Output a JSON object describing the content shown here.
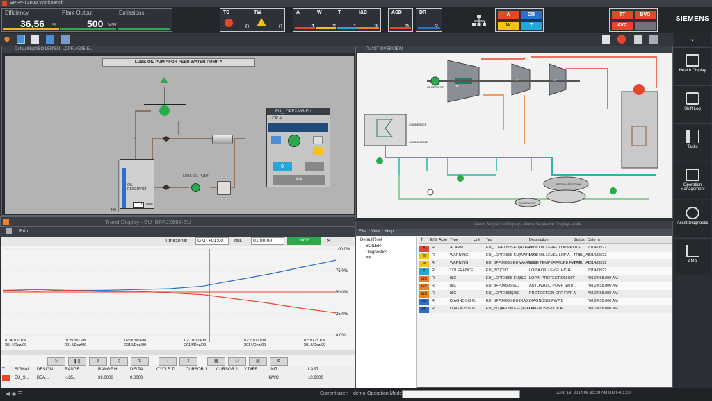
{
  "window_title": "SPPA-T3000 Workbench",
  "kpis": [
    {
      "label": "Efficiency",
      "value": "36,56",
      "unit": "%"
    },
    {
      "label": "Plant Output",
      "value": "500",
      "unit": "MW"
    },
    {
      "label": "Emissions",
      "value": "",
      "unit": ""
    }
  ],
  "alarm_groups": [
    {
      "labels": [
        "TS",
        "TW"
      ],
      "values": [
        "0",
        "0"
      ]
    },
    {
      "labels": [
        "A",
        "W",
        "T",
        "I&C"
      ],
      "values": [
        "1",
        "2",
        "1",
        "3"
      ]
    },
    {
      "labels": [
        "ASD"
      ],
      "values": [
        "9"
      ]
    },
    {
      "labels": [
        "DR"
      ],
      "values": [
        "2"
      ]
    }
  ],
  "quick_buttons_1": [
    {
      "label": "A",
      "color": "#e8462c"
    },
    {
      "label": "DR",
      "color": "#2f6fc9"
    },
    {
      "label": "W",
      "color": "#f3c21b"
    },
    {
      "label": "T",
      "color": "#23a7d9"
    }
  ],
  "quick_buttons_2": [
    {
      "label": "TT",
      "color": "#e8462c"
    },
    {
      "label": "BVG",
      "color": "#e8462c"
    },
    {
      "label": "AVC",
      "color": "#e8462c"
    },
    {
      "label": "",
      "color": "#6e737a"
    }
  ],
  "brand": "SIEMENS",
  "right_panel": [
    {
      "label": "Health Display",
      "icon": "health-display-icon"
    },
    {
      "label": "Shift Log",
      "icon": "shift-log-icon"
    },
    {
      "label": "Tasks",
      "icon": "tasks-icon"
    },
    {
      "label": "Operation Management",
      "icon": "operation-management-icon"
    },
    {
      "label": "Asset Diagnostic",
      "icon": "asset-diagnostic-icon"
    },
    {
      "label": "AMA",
      "icon": "ama-icon"
    }
  ],
  "lube_window": {
    "title": "DefaultRoot\\BOILER\\EU_LOPFLX895-EU",
    "banner": "LUBE OIL PUMP FOR FEED WATER PUMP A",
    "tank_label": "OIL RESERVOIR",
    "tank_value": "71.0",
    "tank_unit": "MMC",
    "pump_label": "LUBE OIL PUMP",
    "scale_top": "",
    "scale_bottom": "-400"
  },
  "faceplate": {
    "title": "EU_LOPFX895-EU",
    "subtitle": "LOP A",
    "input_value": "0",
    "button_label": "Ack"
  },
  "overview": {
    "title": "PLANT OVERVIEW",
    "labels": [
      "HP",
      "IP",
      "LP",
      "CONDENSER",
      "CONDENSATE",
      "FEEDWATER TANK",
      "DEAERATOR",
      "GENERATOR"
    ]
  },
  "trend": {
    "title": "Trend Display - EU_BFPJX895-EU",
    "print": "Print",
    "timezone_label": "Timezone:",
    "timezone": "GMT+01:00",
    "duration_label": "dur.:",
    "duration": "01:00:00",
    "zoom": "100%",
    "y_ticks": [
      "100.0%",
      "75.0%",
      "50.0%",
      "25.0%",
      "0.0%"
    ],
    "x_ticks": [
      [
        "01:40:00 PM",
        "2014/Dez/09"
      ],
      [
        "01:50:00 PM",
        "2014/Dez/09"
      ],
      [
        "02:00:00 PM",
        "2014/Dez/09"
      ],
      [
        "02:10:00 PM",
        "2014/Dez/09"
      ],
      [
        "02:20:00 PM",
        "2014/Dez/09"
      ],
      [
        "02:30:25 PM",
        "2014/Dez/09"
      ]
    ],
    "table_headers": [
      "T...",
      "SIGNAL ...",
      "DESIGN...",
      "RANGE L...",
      "RANGE HI",
      "DELTA",
      "CYCLE TI...",
      "CURSOR 1",
      "CURSOR 2",
      "Y DIFF",
      "UNIT",
      "LAST"
    ],
    "table_row": [
      "",
      "EU_S...",
      "BEA...",
      "-185...",
      "39.0000",
      "0.0000",
      "",
      "",
      "",
      "",
      "INWC",
      "10.0000"
    ]
  },
  "chart_data": {
    "type": "line",
    "x": [
      0,
      10,
      20,
      30,
      40,
      50,
      60,
      70,
      80,
      90,
      100
    ],
    "series": [
      {
        "values": [
          52,
          51,
          52,
          52,
          53,
          54,
          57,
          64,
          71,
          79,
          87
        ]
      },
      {
        "values": [
          52,
          53,
          52,
          51,
          51,
          49,
          47,
          42,
          37,
          31,
          26
        ]
      }
    ],
    "ylim": [
      0,
      100
    ]
  },
  "alarms": {
    "title": "Alarm Sequence Display - Alarm Sequence Display - AMA",
    "menu": [
      "File",
      "View",
      "Help"
    ],
    "tree": [
      "DefaultRoot",
      "BOILER",
      "Diagnostics",
      "EB"
    ],
    "headers": [
      "T",
      "E/S",
      "Actio",
      "Type",
      "Unit",
      "Tag",
      "Description",
      "Status",
      "Date m"
    ],
    "rows": [
      {
        "sev": "A",
        "color": "#e8462c",
        "es": "R",
        "type": "ALARM",
        "tag": "EU_LOPFX895-EU|ALARM",
        "desc": "LOW OIL LEVEL LOP PROTE",
        "status": "",
        "date": "2014/06/22"
      },
      {
        "sev": "W",
        "color": "#f3c21b",
        "es": "R",
        "type": "WARNING",
        "tag": "EU_LOPFX895-EU|WARNING",
        "desc": "LOW OIL LEVEL LOP A",
        "status": "TRBL_AL",
        "date": "2014/06/22"
      },
      {
        "sev": "W",
        "color": "#f3c21b",
        "es": "R",
        "type": "WARNING",
        "tag": "EU_BFPJX895-EU|WARNING",
        "desc": "HIGH TEMPERATURE FWP A",
        "status": "TRBL_AL",
        "date": "2014/06/22"
      },
      {
        "sev": "T",
        "color": "#23a7d9",
        "es": "R",
        "type": "TOLERANCE",
        "tag": "EU_INT|OUT",
        "desc": "LOP A OIL LEVEL HIGH",
        "status": "",
        "date": "2014/06/22"
      },
      {
        "sev": "I&C",
        "color": "#f07f2a",
        "es": "R",
        "type": "I&C",
        "tag": "EU_LOPFX895-EU|I&C",
        "desc": "LOP N PROTECTION OFF",
        "status": "",
        "date": "*08.24.58.000 AM"
      },
      {
        "sev": "I&C",
        "color": "#f07f2a",
        "es": "R",
        "type": "I&C",
        "tag": "EU_BFPJX895|I&C",
        "desc": "AUTOMATIC PUMP SWIT...",
        "status": "",
        "date": "*08.24.58.000 AM"
      },
      {
        "sev": "I&C",
        "color": "#f07f2a",
        "es": "R",
        "type": "I&C",
        "tag": "EU_LOPFX895|I&C",
        "desc": "PROTECTION OFF FWP A",
        "status": "",
        "date": "*08.24.58.000 AM"
      },
      {
        "sev": "DR",
        "color": "#2f6fc9",
        "es": "R",
        "type": "DIAGNOSIS R.",
        "tag": "EU_BFPJX895-EU|DIAG",
        "desc": "DIAGNOSIS FWP B",
        "status": "",
        "date": "*08.24.58.000 AM"
      },
      {
        "sev": "DR",
        "color": "#2f6fc9",
        "es": "R",
        "type": "DIAGNOSIS R.",
        "tag": "EU_INT|AHU001-EU|DIAG",
        "desc": "DIAGNOSIS LOP A",
        "status": "",
        "date": "*08.24.58.000 AM"
      }
    ]
  },
  "status": {
    "user_label": "Current user:",
    "user": "demo",
    "mode_label": "Operation Mode",
    "datetime": "June 18, 2014 08:30:29 AM GMT+01:00"
  }
}
